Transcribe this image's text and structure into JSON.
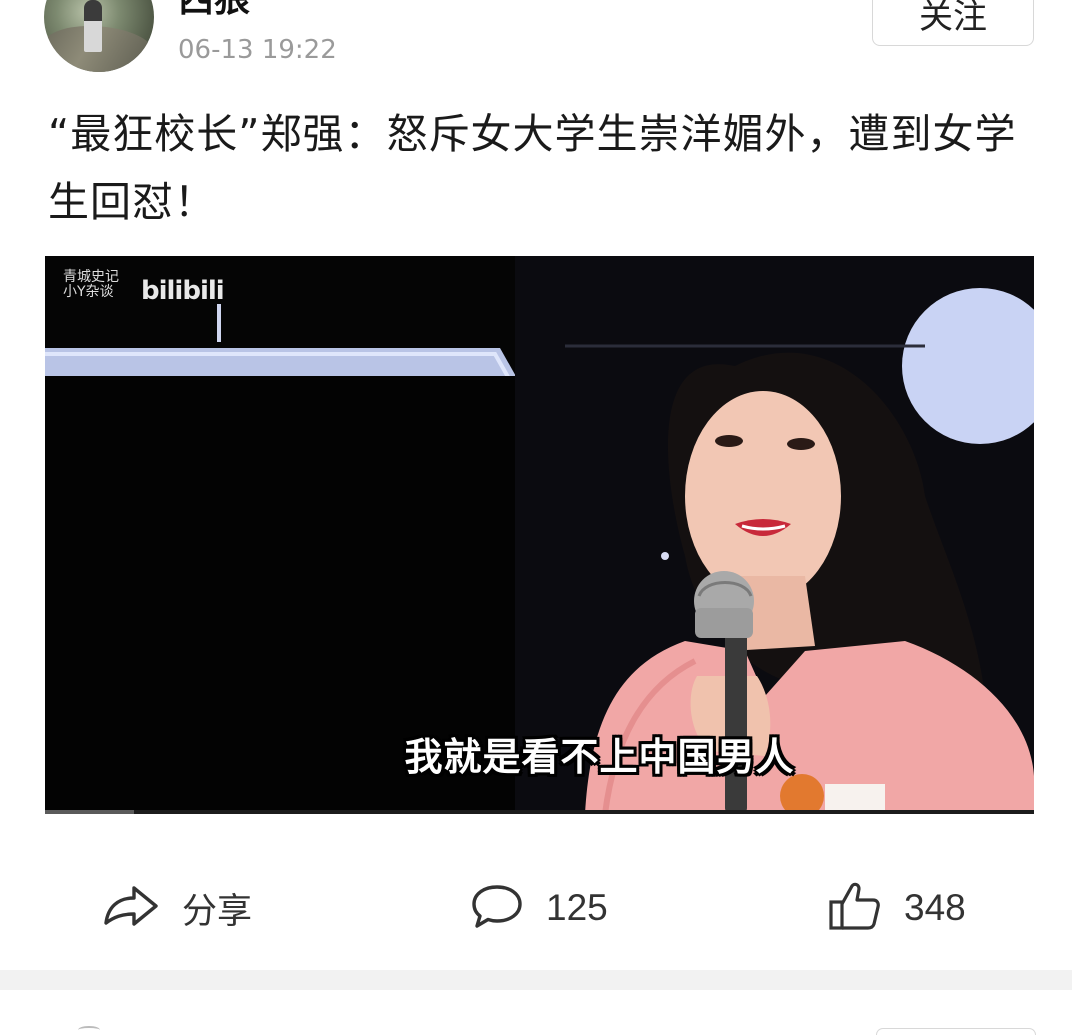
{
  "author": {
    "name": "西狼",
    "time": "06-13  19:22",
    "follow_label": "关注"
  },
  "post": {
    "title": "“最狂校长”郑强：怒斥女大学生崇洋媚外，遭到女学生回怼！"
  },
  "video": {
    "watermark_small_line1": "青城史记",
    "watermark_small_line2": "小Y杂谈",
    "watermark_brand": "bilibili",
    "subtitle": "我就是看不上中国男人",
    "progress": 0.09
  },
  "actions": {
    "share_label": "分享",
    "comment_count": "125",
    "like_count": "348"
  },
  "colors": {
    "text_primary": "#1a1a1a",
    "text_secondary": "#9a9a9a",
    "divider": "#f2f2f2",
    "icon": "#333333"
  }
}
